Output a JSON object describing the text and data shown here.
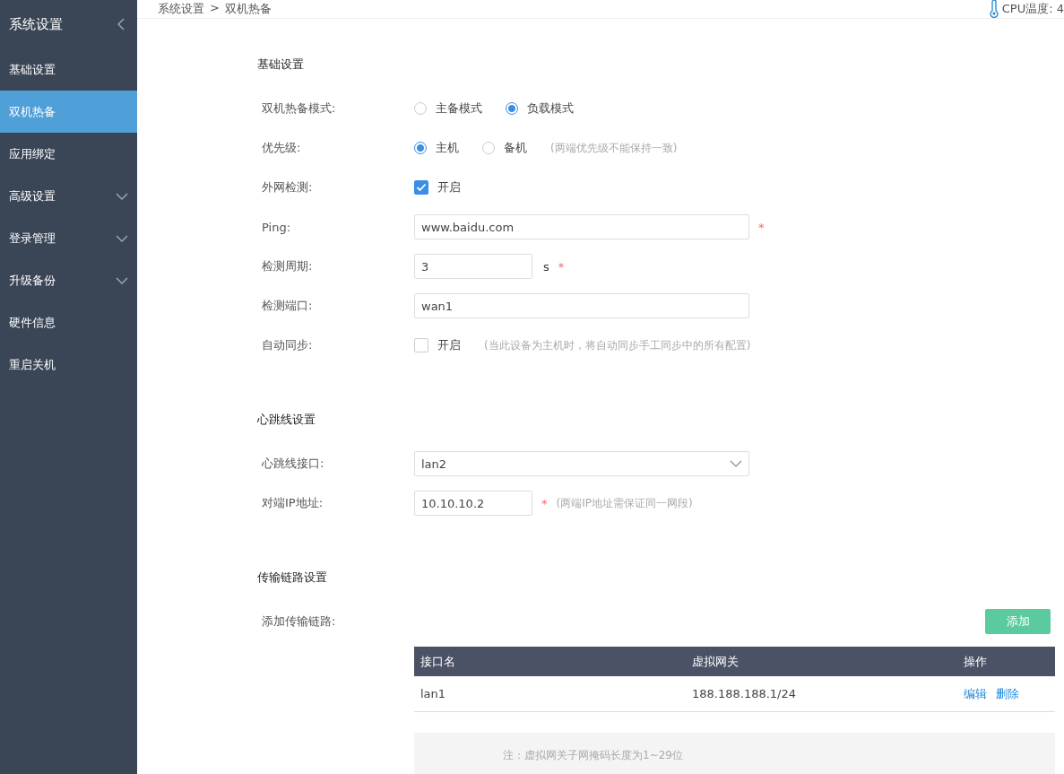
{
  "sidebar": {
    "title": "系统设置",
    "items": [
      {
        "label": "基础设置",
        "selected": false,
        "expandable": false
      },
      {
        "label": "双机热备",
        "selected": true,
        "expandable": false
      },
      {
        "label": "应用绑定",
        "selected": false,
        "expandable": false
      },
      {
        "label": "高级设置",
        "selected": false,
        "expandable": true
      },
      {
        "label": "登录管理",
        "selected": false,
        "expandable": true
      },
      {
        "label": "升级备份",
        "selected": false,
        "expandable": true
      },
      {
        "label": "硬件信息",
        "selected": false,
        "expandable": false
      },
      {
        "label": "重启关机",
        "selected": false,
        "expandable": false
      }
    ]
  },
  "breadcrumb": {
    "path": [
      "系统设置",
      "双机热备"
    ],
    "separator": ">"
  },
  "cpu": {
    "label": "CPU温度: 4"
  },
  "sections": [
    {
      "title": "基础设置",
      "rows": [
        {
          "label": "双机热备模式:",
          "kind": "radio",
          "options": [
            {
              "label": "主备模式",
              "selected": false
            },
            {
              "label": "负载模式",
              "selected": true
            }
          ]
        },
        {
          "label": "优先级:",
          "kind": "radio",
          "options": [
            {
              "label": "主机",
              "selected": true
            },
            {
              "label": "备机",
              "selected": false
            }
          ],
          "hint": "(两端优先级不能保持一致)"
        },
        {
          "label": "外网检测:",
          "kind": "checkbox",
          "checked": true,
          "option": "开启"
        },
        {
          "label": "Ping:",
          "kind": "input",
          "value": "www.baidu.com",
          "required_mark": "*"
        },
        {
          "label": "检测周期:",
          "kind": "short-input",
          "value": "3",
          "unit": "s",
          "required_mark": "*"
        },
        {
          "label": "检测端口:",
          "kind": "input",
          "value": "wan1"
        },
        {
          "label": "自动同步:",
          "kind": "checkbox",
          "checked": false,
          "option": "开启",
          "hint": "(当此设备为主机时，将自动同步手工同步中的所有配置)"
        }
      ]
    },
    {
      "title": "心跳线设置",
      "rows": [
        {
          "label": "心跳线接口:",
          "kind": "select",
          "value": "lan2"
        },
        {
          "label": "对端IP地址:",
          "kind": "short-input",
          "value": "10.10.10.2",
          "required_mark": "*",
          "hint": "(两端IP地址需保证同一网段)"
        }
      ]
    },
    {
      "title": "传输链路设置",
      "rows": [
        {
          "label": "添加传输链路:",
          "kind": "button",
          "button": "添加"
        }
      ],
      "table": {
        "columns": [
          "接口名",
          "虚拟网关",
          "操作"
        ],
        "rows": [
          {
            "cells": [
              "lan1",
              "188.188.188.1/24"
            ],
            "actions": [
              "编辑",
              "删除"
            ]
          }
        ]
      },
      "note": "注：虚拟网关子网掩码长度为1~29位"
    }
  ]
}
